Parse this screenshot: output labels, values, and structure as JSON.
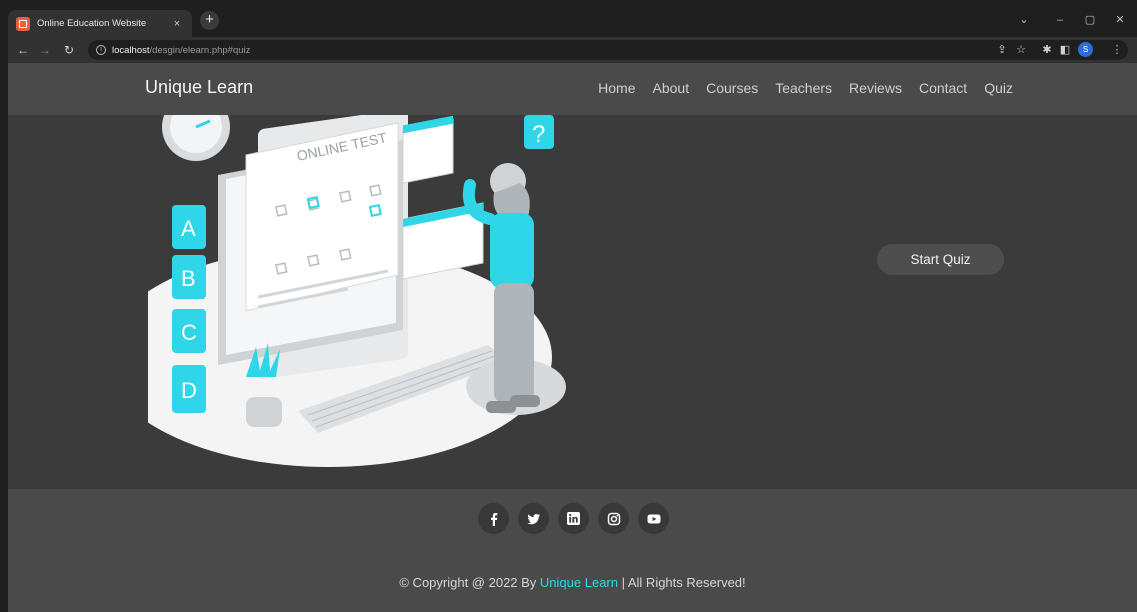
{
  "browser": {
    "tab_title": "Online Education Website",
    "tab_close": "×",
    "new_tab": "+",
    "url_host": "localhost",
    "url_path": "/desgin/elearn.php#quiz",
    "profile_initial": "S"
  },
  "header": {
    "logo": "Unique Learn",
    "nav": [
      "Home",
      "About",
      "Courses",
      "Teachers",
      "Reviews",
      "Contact",
      "Quiz"
    ]
  },
  "hero": {
    "illustration_text": "ONLINE TEST",
    "blocks": [
      "A",
      "B",
      "C",
      "D"
    ],
    "start_button": "Start Quiz"
  },
  "footer": {
    "socials": [
      "facebook-icon",
      "twitter-icon",
      "linkedin-icon",
      "instagram-icon",
      "youtube-icon"
    ],
    "copyright_prefix": "© Copyright @ 2022 By ",
    "brand": "Unique Learn",
    "copyright_suffix": " | All Rights Reserved!",
    "accent": "#2fd6e8"
  }
}
